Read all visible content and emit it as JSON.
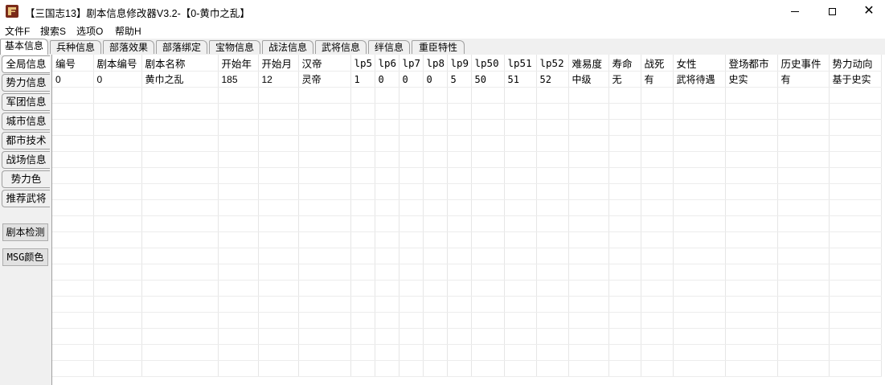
{
  "window": {
    "title": "【三国志13】剧本信息修改器V3.2-【0-黄巾之乱】",
    "min_glyph": "",
    "max_glyph": "",
    "close_glyph": "✕"
  },
  "menu": [
    "文件F",
    "搜索S",
    "选项O",
    "帮助H"
  ],
  "top_tabs": [
    "基本信息",
    "兵种信息",
    "部落效果",
    "部落绑定",
    "宝物信息",
    "战法信息",
    "武将信息",
    "绊信息",
    "重臣特性"
  ],
  "side_tabs": [
    "全局信息",
    "势力信息",
    "军团信息",
    "城市信息",
    "都市技术",
    "战场信息",
    "势力色",
    "推荐武将"
  ],
  "side_buttons": [
    "剧本检测",
    "MSG颜色"
  ],
  "table": {
    "columns": [
      "编号",
      "剧本编号",
      "剧本名称",
      "开始年",
      "开始月",
      "汉帝",
      "lp5",
      "lp6",
      "lp7",
      "lp8",
      "lp9",
      "lp50",
      "lp51",
      "lp52",
      "难易度",
      "寿命",
      "战死",
      "女性",
      "登场都市",
      "历史事件",
      "势力动向"
    ],
    "rows": [
      [
        "0",
        "0",
        "黄巾之乱",
        "185",
        "12",
        "灵帝",
        "1",
        "0",
        "0",
        "0",
        "5",
        "50",
        "51",
        "52",
        "中级",
        "无",
        "有",
        "武将待遇",
        "史实",
        "有",
        "基于史实"
      ]
    ]
  },
  "colors": {
    "panel_bg": "#f0f0f0",
    "grid_line": "#e6e6e6",
    "icon_red": "#7a2a1a"
  }
}
